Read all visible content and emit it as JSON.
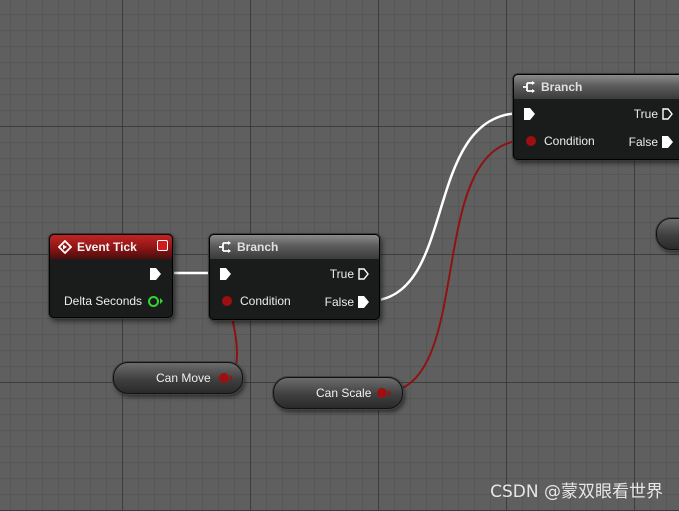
{
  "colors": {
    "canvas_bg": "#5f5f5f",
    "exec_wire": "#ffffff",
    "bool_wire": "#8f1313",
    "bool_pin": "#a00f0f",
    "float_pin": "#33d62e",
    "event_header": "#a01a1a",
    "flow_header": "#6a6a6a"
  },
  "nodes": {
    "event_tick": {
      "title": "Event Tick",
      "icon": "event-diamond-icon",
      "outputs": [
        "exec",
        "Delta Seconds"
      ]
    },
    "branch_1": {
      "title": "Branch",
      "icon": "branch-icon",
      "input_label": "Condition",
      "true_label": "True",
      "false_label": "False"
    },
    "branch_2": {
      "title": "Branch",
      "icon": "branch-icon",
      "input_label": "Condition",
      "true_label": "True",
      "false_label": "False"
    }
  },
  "variables": {
    "can_move": {
      "label": "Can Move"
    },
    "can_scale": {
      "label": "Can Scale"
    }
  },
  "watermark": "CSDN @蒙双眼看世界"
}
